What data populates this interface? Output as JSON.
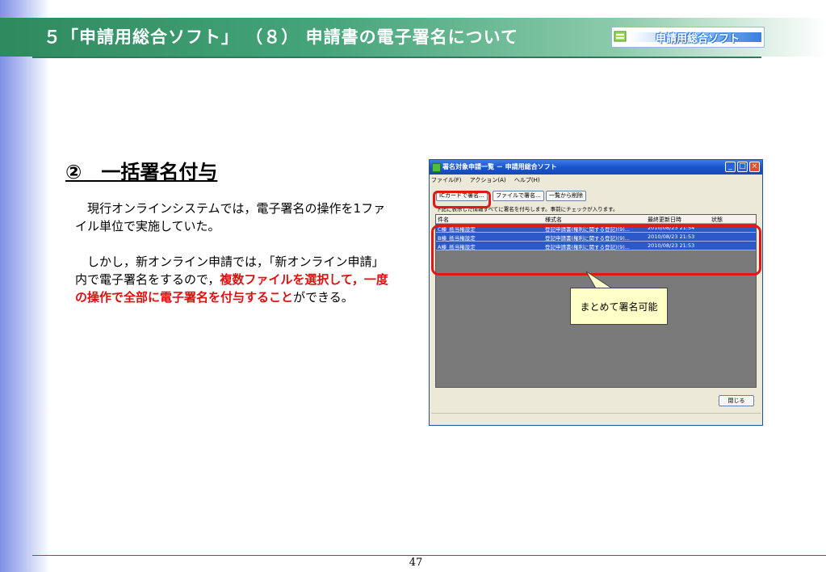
{
  "header": {
    "title": "５「申請用総合ソフト」 （８） 申請書の電子署名について",
    "logo_text": "申請用総合ソフト"
  },
  "section": {
    "title": "②　一括署名付与"
  },
  "body": {
    "para1": "　現行オンラインシステムでは，電子署名の操作を1ファイル単位で実施していた。",
    "para2_a": "　しかし，新オンライン申請では，「新オンライン申請」内で電子署名をするので，",
    "para2_highlight": "複数ファイルを選択して，一度の操作で全部に電子署名を付与すること",
    "para2_b": "ができる。"
  },
  "window": {
    "title": "署名対象申請一覧 － 申請用総合ソフト",
    "menu": [
      "ファイル(F)",
      "アクション(A)",
      "ヘルプ(H)"
    ],
    "toolbar": {
      "ic_card_sign": "ICカードで署名...",
      "file_sign": "ファイルで署名...",
      "remove_from_list": "一覧から削除"
    },
    "note": "下記に表示した情報すべてに署名を付与します。事前にチェックが入ります。",
    "columns": [
      "件名",
      "様式名",
      "最終更新日時",
      "状態"
    ],
    "rows": [
      {
        "subject": "C棟_抵当権設定",
        "form": "登記申請書(権利に関する登記)(9)...",
        "updated": "2010/08/23 21:54",
        "status": ""
      },
      {
        "subject": "B棟_抵当権設定",
        "form": "登記申請書(権利に関する登記)(9)...",
        "updated": "2010/08/23 21:53",
        "status": ""
      },
      {
        "subject": "A棟_抵当権設定",
        "form": "登記申請書(権利に関する登記)(9)...",
        "updated": "2010/08/23 21:53",
        "status": ""
      }
    ],
    "close_label": "閉じる"
  },
  "callout": {
    "text": "まとめて署名可能"
  },
  "footer": {
    "page_number": "47"
  },
  "colors": {
    "header_green": "#2e8a5e",
    "highlight_red": "#e01010",
    "selection_blue": "#2b59c8",
    "callout_yellow": "#ffffc8"
  }
}
